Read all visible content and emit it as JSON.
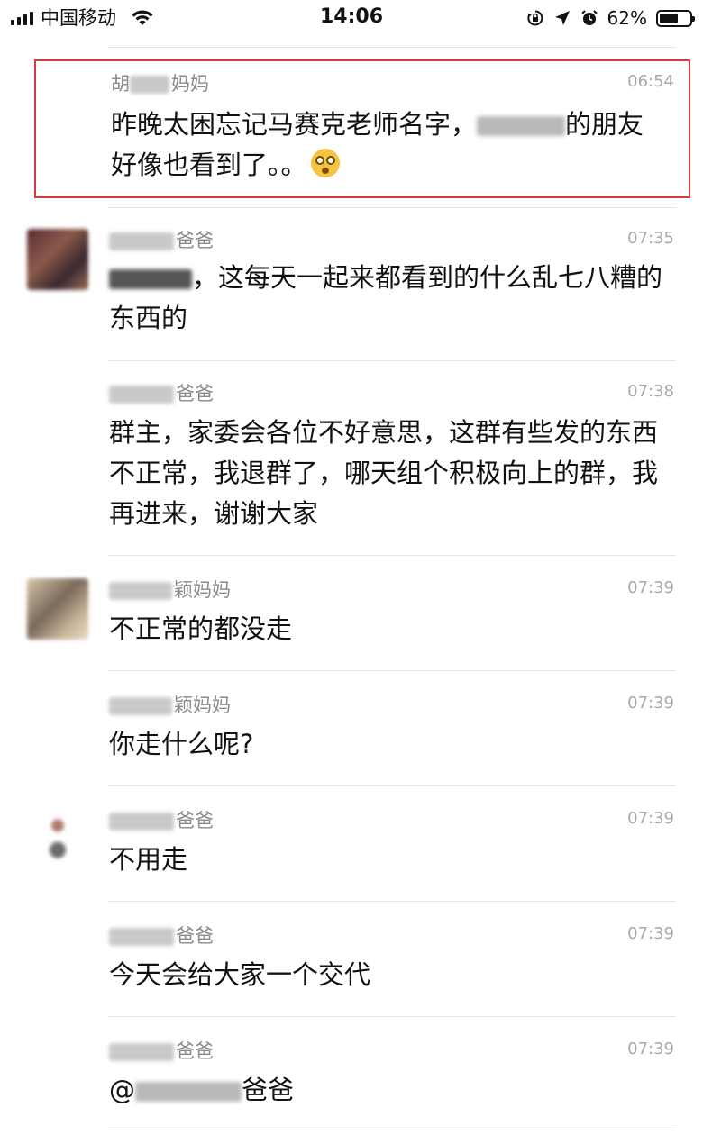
{
  "status_bar": {
    "carrier": "中国移动",
    "time": "14:06",
    "battery_percent": "62%",
    "battery_level": 0.62
  },
  "messages": [
    {
      "name_suffix": "妈妈",
      "name_prefix_visible": "胡",
      "time": "06:54",
      "text_before": "昨晚太困忘记马赛克老师名字，",
      "text_after": "的朋友好像也看到了。。",
      "emoji": "flushed-face",
      "highlighted": true
    },
    {
      "name_suffix": "爸爸",
      "time": "07:35",
      "text_after": "，这每天一起来都看到的什么乱七八糟的东西的"
    },
    {
      "name_suffix": "爸爸",
      "time": "07:38",
      "text": "群主，家委会各位不好意思，这群有些发的东西不正常，我退群了，哪天组个积极向上的群，我再进来，谢谢大家"
    },
    {
      "name_suffix": "颖妈妈",
      "time": "07:39",
      "text": "不正常的都没走"
    },
    {
      "name_suffix": "颖妈妈",
      "time": "07:39",
      "text": "你走什么呢?"
    },
    {
      "name_suffix": "爸爸",
      "time": "07:39",
      "text": "不用走"
    },
    {
      "name_suffix": "爸爸",
      "time": "07:39",
      "text": "今天会给大家一个交代"
    },
    {
      "name_suffix": "爸爸",
      "time": "07:39",
      "text_before": "@",
      "text_after": "爸爸"
    }
  ]
}
